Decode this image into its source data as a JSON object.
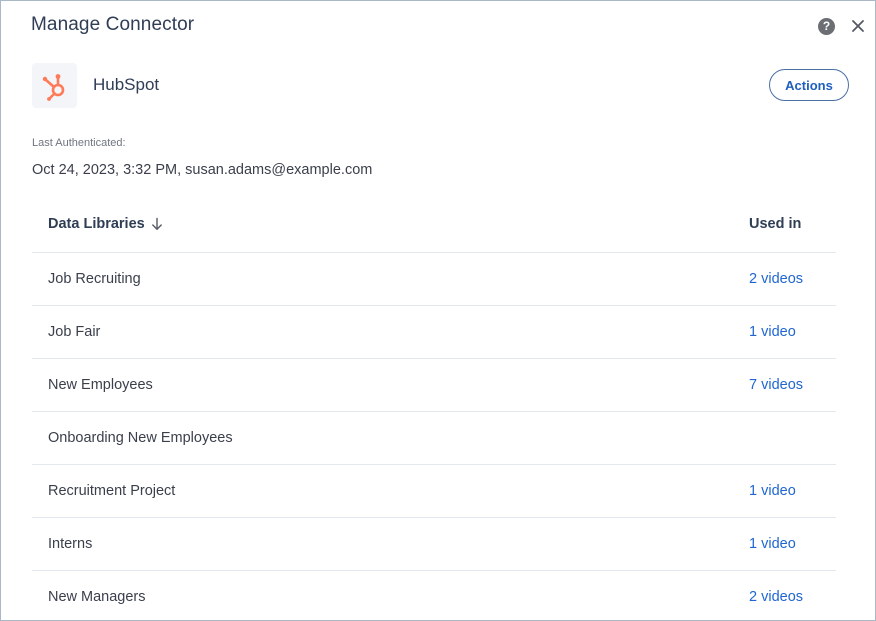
{
  "dialog": {
    "title": "Manage Connector",
    "help_glyph": "?",
    "icons": {
      "help": "help-circle-icon",
      "close": "close-icon"
    }
  },
  "connector": {
    "name": "HubSpot",
    "logo_icon": "hubspot-logo-icon",
    "brand_color": "#ff7a59",
    "actions_label": "Actions"
  },
  "auth": {
    "label": "Last Authenticated:",
    "value": "Oct 24, 2023, 3:32 PM, susan.adams@example.com"
  },
  "table": {
    "columns": {
      "library": "Data Libraries",
      "used_in": "Used in"
    },
    "sort_icon": "arrow-down-icon",
    "rows": [
      {
        "name": "Job Recruiting",
        "used_in": "2 videos"
      },
      {
        "name": "Job Fair",
        "used_in": "1 video"
      },
      {
        "name": "New Employees",
        "used_in": "7 videos"
      },
      {
        "name": "Onboarding New Employees",
        "used_in": ""
      },
      {
        "name": "Recruitment Project",
        "used_in": "1 video"
      },
      {
        "name": "Interns",
        "used_in": "1 video"
      },
      {
        "name": "New Managers",
        "used_in": "2 videos"
      }
    ]
  },
  "colors": {
    "title_text": "#2f3d55",
    "link": "#1f66d1",
    "divider": "#e3e7ee",
    "border": "#a9b7c6"
  }
}
